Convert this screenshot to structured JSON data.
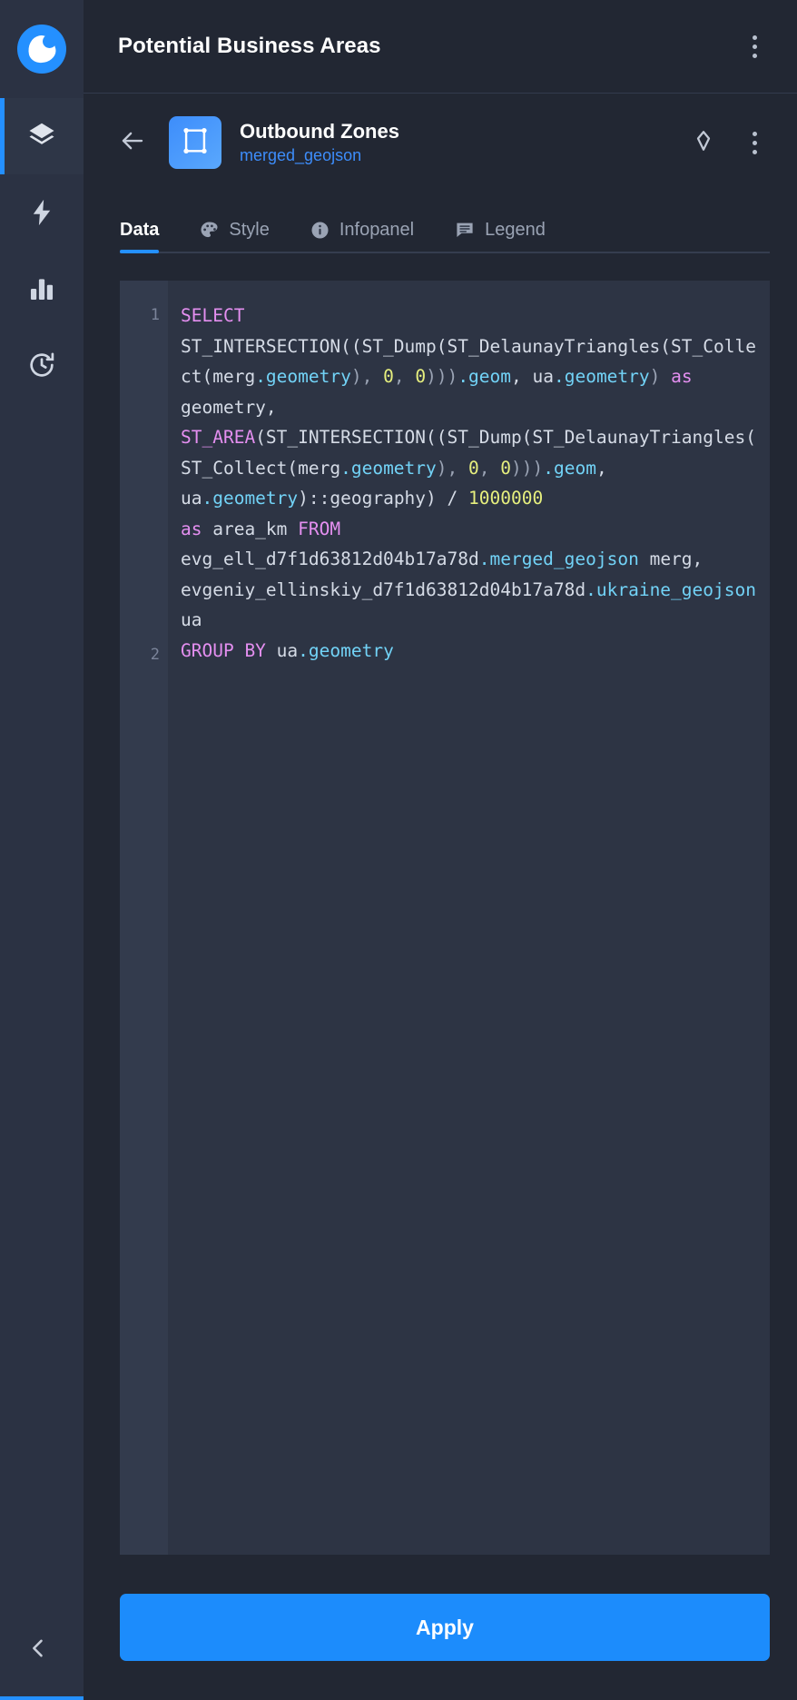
{
  "rail": {
    "logo": {
      "icon": "app-logo-icon"
    },
    "items": [
      {
        "id": "layers",
        "icon": "layers-icon",
        "active": true
      },
      {
        "id": "actions",
        "icon": "lightning-icon",
        "active": false
      },
      {
        "id": "analytics",
        "icon": "bar-chart-icon",
        "active": false
      },
      {
        "id": "history",
        "icon": "history-icon",
        "active": false
      }
    ],
    "collapse": {
      "icon": "chevron-left-icon"
    }
  },
  "projectbar": {
    "title": "Potential Business Areas",
    "menu_icon": "kebab-menu-icon"
  },
  "layer": {
    "back_icon": "arrow-left-icon",
    "thumb_icon": "bounding-box-icon",
    "name": "Outbound Zones",
    "source": "merged_geojson",
    "locate_icon": "locate-target-icon",
    "menu_icon": "kebab-menu-icon"
  },
  "tabs": [
    {
      "id": "data",
      "label": "Data",
      "icon": null,
      "active": true
    },
    {
      "id": "style",
      "label": "Style",
      "icon": "palette-icon",
      "active": false
    },
    {
      "id": "infopanel",
      "label": "Infopanel",
      "icon": "info-icon",
      "active": false
    },
    {
      "id": "legend",
      "label": "Legend",
      "icon": "legend-icon",
      "active": false
    }
  ],
  "editor": {
    "line_numbers": [
      "1",
      "2"
    ],
    "sql": "SELECT ST_INTERSECTION((ST_Dump(ST_DelaunayTriangles(ST_Collect(merg.geometry), 0, 0))).geom, ua.geometry) as geometry, ST_AREA(ST_INTERSECTION((ST_Dump(ST_DelaunayTriangles(ST_Collect(merg.geometry), 0, 0))).geom, ua.geometry)::geography) / 1000000 as area_km FROM evg_ell_d7f1d63812d04b17a78d.merged_geojson merg, evgeniy_ellinskiy_d7f1d63812d04b17a78d.ukraine_geojson ua\nGROUP BY ua.geometry",
    "tokens": [
      {
        "t": "SELECT",
        "c": "kw"
      },
      {
        "t": "\n",
        "c": "plain"
      },
      {
        "t": "ST_INTERSECTION((ST_Dump(ST_DelaunayTriangles(ST_Collect(merg",
        "c": "plain"
      },
      {
        "t": ".geometry",
        "c": "prop"
      },
      {
        "t": "), ",
        "c": "pl"
      },
      {
        "t": "0",
        "c": "num"
      },
      {
        "t": ", ",
        "c": "pl"
      },
      {
        "t": "0",
        "c": "num"
      },
      {
        "t": ")))",
        "c": "pl"
      },
      {
        "t": ".geom",
        "c": "prop"
      },
      {
        "t": ", ua",
        "c": "plain"
      },
      {
        "t": ".geometry",
        "c": "prop"
      },
      {
        "t": ") ",
        "c": "pl"
      },
      {
        "t": "as",
        "c": "kw"
      },
      {
        "t": " geometry,\n",
        "c": "plain"
      },
      {
        "t": "ST_AREA",
        "c": "kw"
      },
      {
        "t": "(ST_INTERSECTION((ST_Dump(ST_DelaunayTriangles(ST_Collect(merg",
        "c": "plain"
      },
      {
        "t": ".geometry",
        "c": "prop"
      },
      {
        "t": "), ",
        "c": "pl"
      },
      {
        "t": "0",
        "c": "num"
      },
      {
        "t": ", ",
        "c": "pl"
      },
      {
        "t": "0",
        "c": "num"
      },
      {
        "t": ")))",
        "c": "pl"
      },
      {
        "t": ".geom",
        "c": "prop"
      },
      {
        "t": ", ua",
        "c": "plain"
      },
      {
        "t": ".geometry",
        "c": "prop"
      },
      {
        "t": ")::geography) / ",
        "c": "plain"
      },
      {
        "t": "1000000",
        "c": "num"
      },
      {
        "t": "\n",
        "c": "plain"
      },
      {
        "t": "as",
        "c": "kw"
      },
      {
        "t": " area_km ",
        "c": "plain"
      },
      {
        "t": "FROM",
        "c": "kw"
      },
      {
        "t": " evg_ell_d7f1d63812d04b17a78d",
        "c": "plain"
      },
      {
        "t": ".merged_geojson",
        "c": "prop"
      },
      {
        "t": " merg,\nevgeniy_ellinskiy_d7f1d63812d04b17a78d",
        "c": "plain"
      },
      {
        "t": ".ukraine_geojson",
        "c": "prop"
      },
      {
        "t": " ua\n",
        "c": "plain"
      },
      {
        "t": "GROUP BY",
        "c": "kw"
      },
      {
        "t": " ua",
        "c": "plain"
      },
      {
        "t": ".geometry",
        "c": "prop"
      }
    ]
  },
  "footer": {
    "apply_label": "Apply"
  },
  "colors": {
    "accent": "#2490ff",
    "apply": "#1c8cfc",
    "panel_bg": "#222733",
    "rail_bg": "#2b3243",
    "editor_bg": "#2d3444",
    "gutter_bg": "#333b4d",
    "link": "#3d8dfb",
    "keyword": "#e48ff0",
    "number": "#e6ef7e",
    "property": "#72d3f7",
    "text": "#d5dbe6"
  }
}
